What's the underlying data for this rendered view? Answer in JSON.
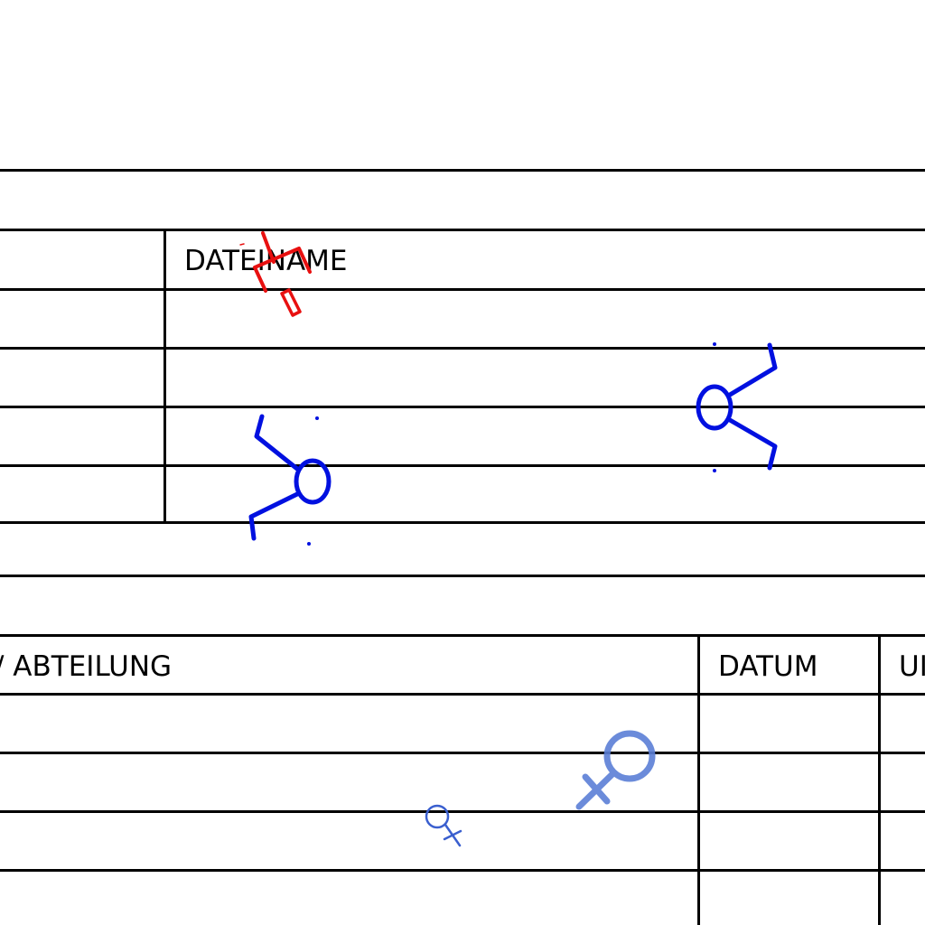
{
  "sheet": {
    "upper_table": {
      "header_label": "DATEINAME"
    },
    "lower_table": {
      "col1_label": "/ ABTEILUNG",
      "col2_label": "DATUM",
      "col3_label": "UI"
    }
  },
  "symbols": [
    {
      "name": "anchor-crosshair-marker",
      "color": "#ff0000"
    },
    {
      "name": "outgoing-arrow-marker-left",
      "color": "#0000dd"
    },
    {
      "name": "outgoing-arrow-marker-right",
      "color": "#0000dd"
    },
    {
      "name": "female-symbol-large",
      "color": "#5b7fd6"
    },
    {
      "name": "female-symbol-small",
      "color": "#3a5fcf"
    }
  ]
}
